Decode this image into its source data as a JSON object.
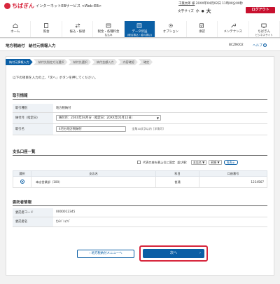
{
  "header": {
    "logo_text": "ちばぎん",
    "service_name": "インターネットEBサービス <Web-EB>",
    "user_name": "千葉太郎 様",
    "last_login": "20XX年04月02日 11時00分00秒",
    "font_size_label": "文字サイズ",
    "font_small": "小",
    "font_medium": "中",
    "font_large": "大",
    "logout_label": "ログアウト"
  },
  "nav": [
    {
      "label": "ホーム",
      "sub": "",
      "icon": "home-icon",
      "active": false
    },
    {
      "label": "照会",
      "sub": "",
      "icon": "document-search-icon",
      "active": false
    },
    {
      "label": "振込・振替",
      "sub": "",
      "icon": "transfer-icon",
      "active": false
    },
    {
      "label": "税金・各種料金",
      "sub": "払込み",
      "icon": "tax-payment-icon",
      "active": false
    },
    {
      "label": "データ伝送",
      "sub": "(総合振込・給与振込)",
      "icon": "data-transfer-icon",
      "active": true
    },
    {
      "label": "オプション",
      "sub": "",
      "icon": "gear-icon",
      "active": false
    },
    {
      "label": "承認",
      "sub": "",
      "icon": "approve-icon",
      "active": false
    },
    {
      "label": "メンテナンス",
      "sub": "",
      "icon": "wrench-icon",
      "active": false
    },
    {
      "label": "ちばぎん",
      "sub": "ビジネスサイト",
      "icon": "business-site-icon",
      "active": false
    }
  ],
  "page": {
    "title": "地方税納付　納付元情報入力",
    "screen_id": "BCZN002",
    "help_label": "ヘルプ"
  },
  "steps": [
    {
      "label": "納付元情報入力",
      "active": true
    },
    {
      "label": "納付先指定方法選択",
      "active": false
    },
    {
      "label": "納付先選択",
      "active": false
    },
    {
      "label": "納付金額入力",
      "active": false
    },
    {
      "label": "内容確認",
      "active": false
    },
    {
      "label": "確定",
      "active": false
    }
  ],
  "instruction": "以下の項目を入力の上、「次へ」ボタンを押してください。",
  "transaction": {
    "section_title": "取引情報",
    "rows": [
      {
        "label": "取引種別",
        "value": "地方税納付"
      },
      {
        "label": "納付月（指定日）",
        "value": "納付月：20XX年04月分（指定日：20XX年05月12日）"
      },
      {
        "label": "取引名",
        "value": "4月分地方税納付",
        "note": "全角10文字以内［半角可］"
      }
    ]
  },
  "accounts": {
    "section_title": "支払口座一覧",
    "move_top_label": "代表口座を最上位に固定",
    "sort_label": "並び順：",
    "sort_key": "支店名",
    "sort_order": "昇順",
    "resort_label": "再表示",
    "columns": [
      "選択",
      "支店名",
      "科目",
      "口座番号"
    ],
    "rows": [
      {
        "branch": "本店営業部（100）",
        "type": "普通",
        "number": "1234567"
      }
    ]
  },
  "payer": {
    "section_title": "委託者情報",
    "rows": [
      {
        "label": "委託者コード",
        "value": "0000012345"
      },
      {
        "label": "委託者名",
        "value": "ｶ)ﾁﾊﾞｼｮｳｼﾞ"
      }
    ]
  },
  "buttons": {
    "back_label": "地方税納付メニューへ",
    "next_label": "次へ"
  },
  "colors": {
    "brand_red": "#d7263d",
    "primary_blue": "#0b5fa5"
  }
}
